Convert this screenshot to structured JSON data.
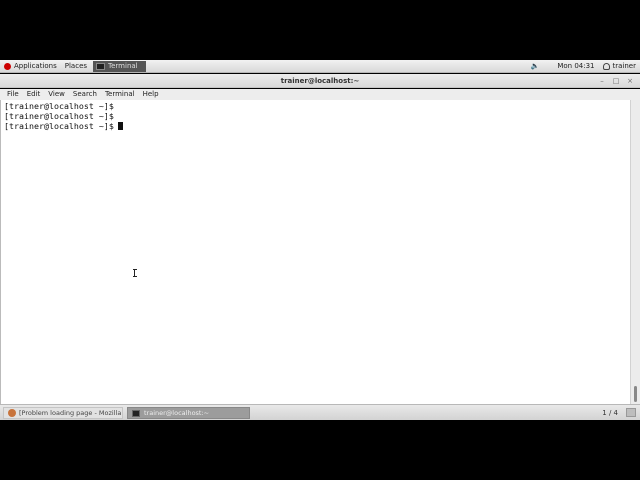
{
  "top_panel": {
    "applications_label": "Applications",
    "places_label": "Places",
    "task_label": "Terminal",
    "clock": "Mon 04:31",
    "user": "trainer"
  },
  "window": {
    "title": "trainer@localhost:~"
  },
  "menubar": {
    "items": [
      "File",
      "Edit",
      "View",
      "Search",
      "Terminal",
      "Help"
    ]
  },
  "terminal": {
    "lines": [
      "[trainer@localhost ~]$",
      "[trainer@localhost ~]$",
      "[trainer@localhost ~]$"
    ]
  },
  "taskbar": {
    "tasks": [
      {
        "label": "[Problem loading page - Mozilla ..."
      },
      {
        "label": "trainer@localhost:~"
      }
    ],
    "workspace": "1 / 4"
  }
}
